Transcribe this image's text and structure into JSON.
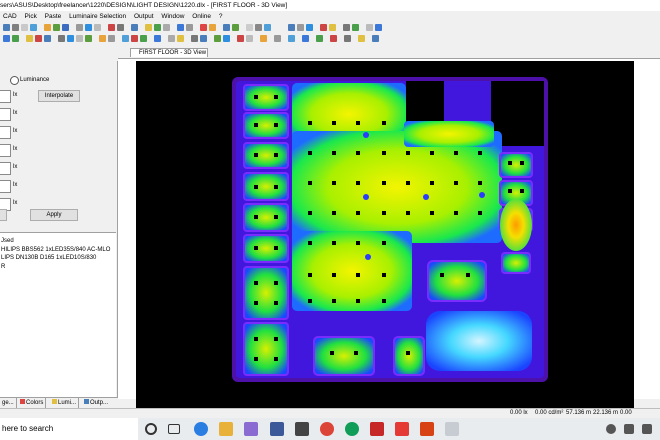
{
  "window": {
    "title": "sers\\ASUS\\Desktop\\freelancer\\1220\\DESIGN\\LIGHT DESIGN\\1220.dlx - [FIRST FLOOR - 3D View]"
  },
  "menu": [
    "CAD",
    "Pick",
    "Paste",
    "Luminaire Selection",
    "Output",
    "Window",
    "Online",
    "?"
  ],
  "left_panel": {
    "luminance_label": "Luminance",
    "unit": "lx",
    "interpolate_label": "Interpolate",
    "apply_label": "Apply",
    "used_items": [
      "Jsed",
      "HILIPS  BBS562 1xLED35S/840 AC-MLO",
      "LIPS  DN130B D165 1xLED10S/830",
      "R"
    ],
    "tabs": [
      "ge...",
      "Colors",
      "Lumi...",
      "Outp..."
    ]
  },
  "view": {
    "tab_label": "FIRST FLOOR - 3D View"
  },
  "status": {
    "illuminance": "0.00 lx",
    "luminance": "0.00 cd/m²",
    "x": "57.136 m",
    "y": "22.136 m",
    "z": "0.00"
  },
  "taskbar": {
    "search_text": "here to search"
  },
  "colors": {
    "accent_blue": "#0078d7",
    "render_background": "#000000"
  }
}
